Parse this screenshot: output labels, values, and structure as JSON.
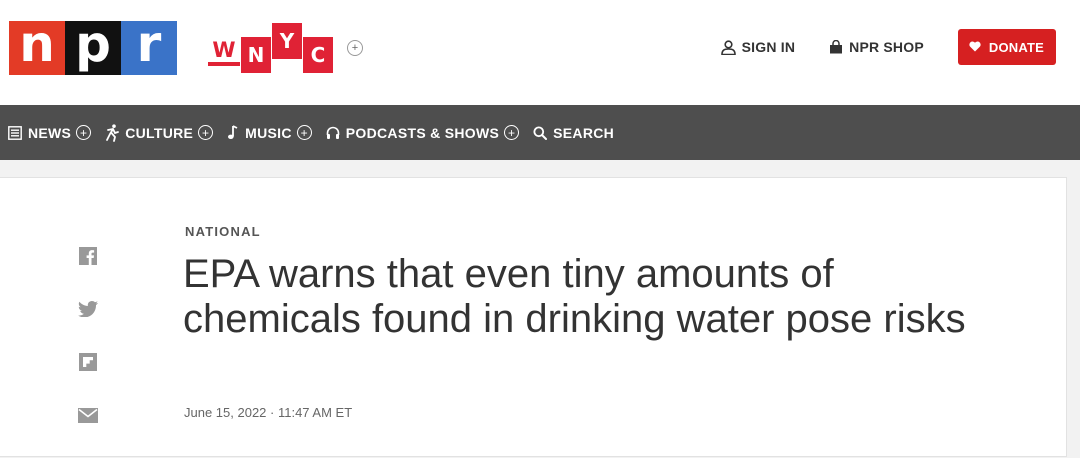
{
  "header": {
    "npr_logo": [
      "n",
      "p",
      "r"
    ],
    "wnyc_logo": [
      "W",
      "N",
      "Y",
      "C"
    ],
    "station_toggle": "+",
    "sign_in": "SIGN IN",
    "shop": "NPR SHOP",
    "donate": "DONATE"
  },
  "nav": {
    "items": [
      {
        "label": "NEWS",
        "icon": "list-icon"
      },
      {
        "label": "CULTURE",
        "icon": "culture-icon"
      },
      {
        "label": "MUSIC",
        "icon": "music-note-icon"
      },
      {
        "label": "PODCASTS & SHOWS",
        "icon": "headphones-icon"
      },
      {
        "label": "SEARCH",
        "icon": "search-icon"
      }
    ],
    "expand": "+"
  },
  "article": {
    "section": "NATIONAL",
    "headline": "EPA warns that even tiny amounts of chemicals found in drinking water pose risks",
    "dateline": "June 15, 2022 · 11:47 AM ET"
  },
  "share": [
    "facebook-icon",
    "twitter-icon",
    "flipboard-icon",
    "email-icon"
  ],
  "colors": {
    "npr_red": "#e33b26",
    "npr_black": "#111111",
    "npr_blue": "#3a73c8",
    "wnyc_red": "#e02235",
    "donate_red": "#d62021",
    "nav_bg": "#4e4e4e"
  }
}
